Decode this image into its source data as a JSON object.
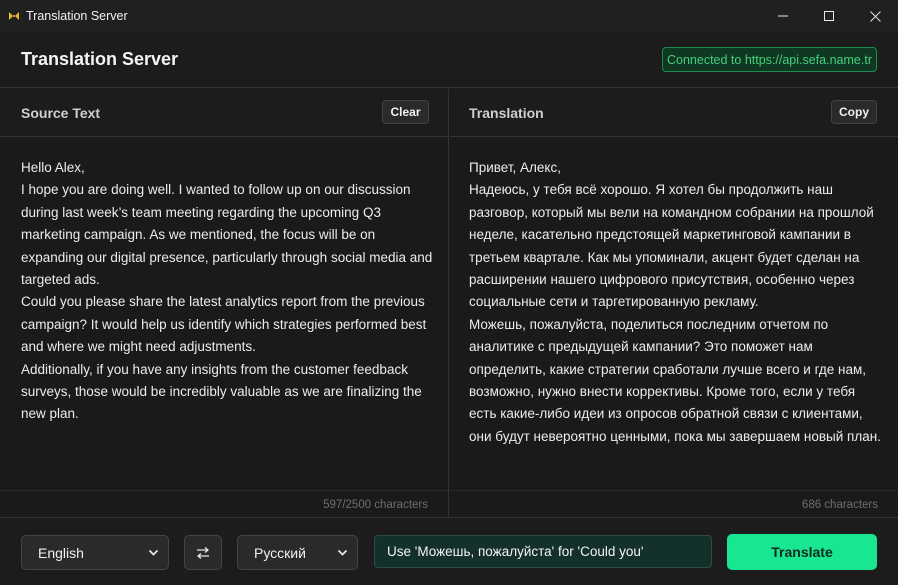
{
  "window": {
    "title": "Translation Server",
    "icon": "app-logo-icon"
  },
  "header": {
    "title": "Translation Server",
    "status": "Connected to https://api.sefa.name.tr",
    "status_color": "#43d07a"
  },
  "source": {
    "title": "Source Text",
    "clear_label": "Clear",
    "paragraphs": [
      "Hello Alex,",
      "I hope you are doing well. I wanted to follow up on our discussion during last week’s team meeting regarding the upcoming Q3 marketing campaign. As we mentioned, the focus will be on expanding our digital presence, particularly through social media and targeted ads.",
      "Could you please share the latest analytics report from the previous campaign? It would help us identify which strategies performed best and where we might need adjustments.",
      "Additionally, if you have any insights from the customer feedback surveys, those would be incredibly valuable as we are finalizing the new plan."
    ],
    "char_count": "597/2500 characters"
  },
  "translation": {
    "title": "Translation",
    "copy_label": "Copy",
    "paragraphs": [
      "Привет, Алекс,",
      "Надеюсь, у тебя всё хорошо. Я хотел бы продолжить наш разговор, который мы вели на командном собрании на прошлой неделе, касательно предстоящей маркетинговой кампании в третьем квартале. Как мы упоминали, акцент будет сделан на расширении нашего цифрового присутствия, особенно через социальные сети и таргетированную рекламу.",
      "Можешь, пожалуйста, поделиться последним отчетом по аналитике с предыдущей кампании? Это поможет нам определить, какие стратегии сработали лучше всего и где нам, возможно, нужно внести коррективы. Кроме того, если у тебя есть какие-либо идеи из опросов обратной связи с клиентами, они будут невероятно ценными, пока мы завершаем новый план."
    ],
    "char_count": "686 characters"
  },
  "controls": {
    "source_language": "English",
    "swap_icon": "swap-arrows-icon",
    "target_language": "Русский",
    "hint_value": "Use 'Можешь, пожалуйста' for 'Could you'",
    "translate_label": "Translate",
    "accent_color": "#18e690"
  }
}
